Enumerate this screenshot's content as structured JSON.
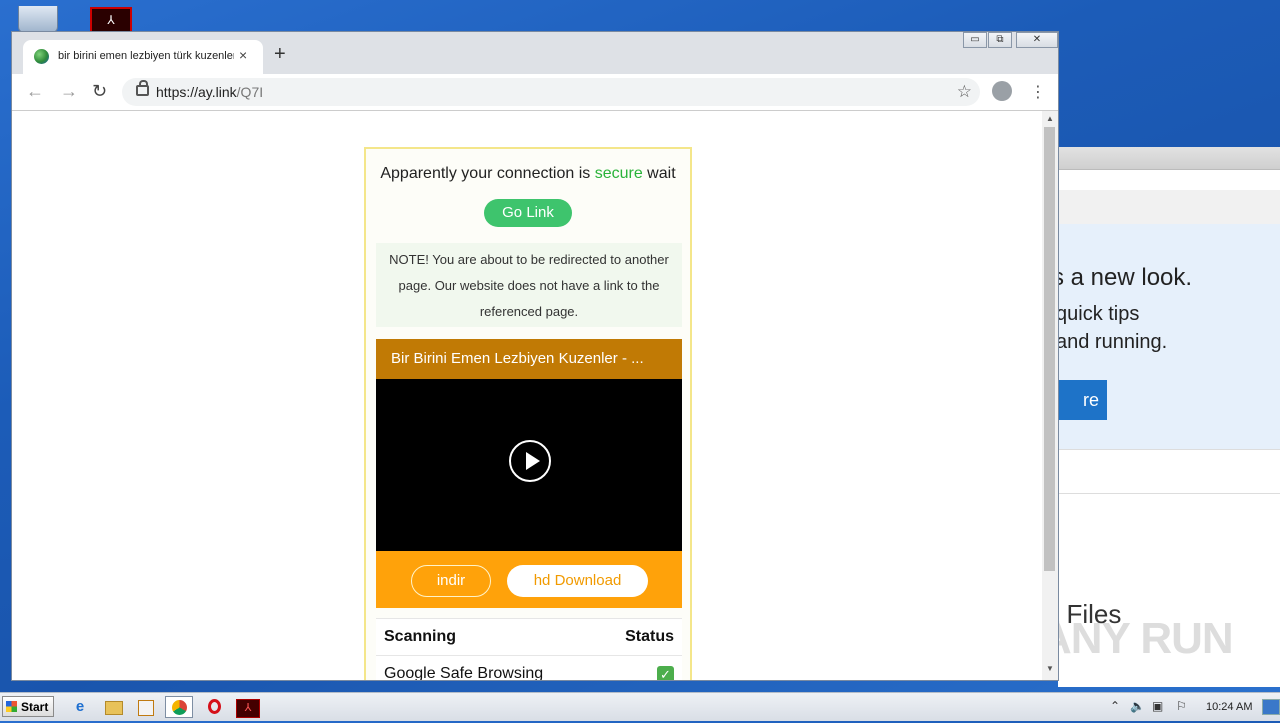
{
  "browser": {
    "tab_title": "bir birini emen lezbiyen türk kuzenler",
    "tab_close": "×",
    "new_tab": "+",
    "url_host": "https://ay.link",
    "url_path": "/Q7I",
    "window_controls": {
      "minimize": "▭",
      "restore": "⧉",
      "close": "✕"
    }
  },
  "page": {
    "headline_pre": "Apparently your connection is ",
    "headline_green": "secure",
    "headline_post": " wait",
    "go_link": "Go Link",
    "note": "NOTE! You are about to be redirected to another page. Our website does not have a link to the referenced page.",
    "video_title": "Bir Birini Emen Lezbiyen Kuzenler - ...",
    "indir": "indir",
    "hd_download": "hd Download",
    "scan_header": "Scanning",
    "status_header": "Status",
    "scan_rows": [
      {
        "label": "Google Safe Browsing",
        "status": "✓"
      }
    ],
    "accent_green": "#3ec46d",
    "accent_orange": "#ffa20a"
  },
  "background_window": {
    "headline": "s a new look.",
    "line1": "quick tips",
    "line2": "and running.",
    "button": "re",
    "files": "t Files"
  },
  "watermark": "ANY RUN",
  "taskbar": {
    "start": "Start",
    "clock": "10:24 AM"
  }
}
